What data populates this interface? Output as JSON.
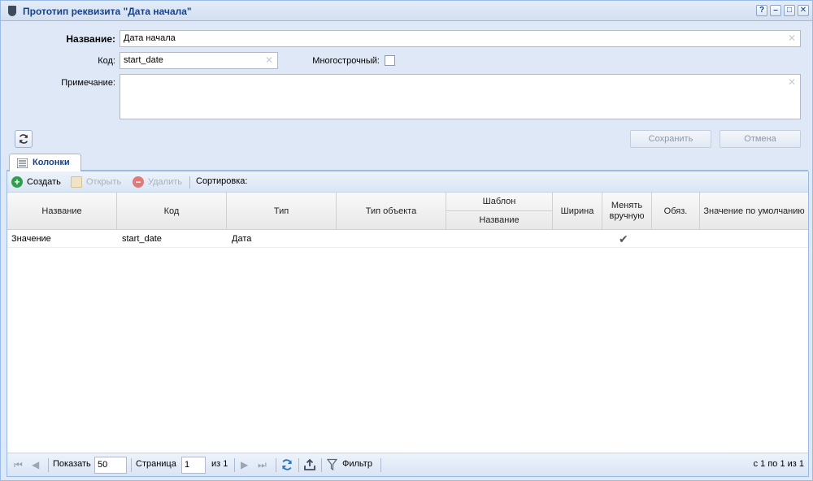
{
  "window": {
    "title": "Прототип реквизита \"Дата начала\"",
    "tools": {
      "help": "?",
      "minimize": "–",
      "maximize": "□",
      "close": "✕"
    }
  },
  "form": {
    "name_label": "Название:",
    "name_value": "Дата начала",
    "code_label": "Код:",
    "code_value": "start_date",
    "multiline_label": "Многострочный:",
    "multiline_checked": false,
    "note_label": "Примечание:",
    "note_value": "",
    "save_label": "Сохранить",
    "cancel_label": "Отмена"
  },
  "tabs": [
    {
      "label": "Колонки",
      "active": true
    }
  ],
  "toolbar": {
    "create_label": "Создать",
    "open_label": "Открыть",
    "delete_label": "Удалить",
    "sort_label": "Сортировка:"
  },
  "grid": {
    "headers": {
      "name": "Название",
      "code": "Код",
      "type": "Тип",
      "object_type": "Тип объекта",
      "template": "Шаблон",
      "template_name": "Название",
      "width": "Ширина",
      "change_manually": "Менять вручную",
      "required": "Обяз.",
      "default_value": "Значение по умолчанию"
    },
    "rows": [
      {
        "name": "Значение",
        "code": "start_date",
        "type": "Дата",
        "object_type": "",
        "template_name": "",
        "width": "",
        "change_manually": "✔",
        "required": "",
        "default_value": ""
      }
    ]
  },
  "pager": {
    "show_label": "Показать",
    "page_size": "50",
    "page_label": "Страница",
    "page_number": "1",
    "of_label": "из 1",
    "filter_label": "Фильтр",
    "range_label": "с 1 по 1 из 1"
  },
  "colors": {
    "accent": "#15428b",
    "frame": "#99bbe8",
    "background": "#dfe8f6",
    "create_icon": "#2f9f4f",
    "delete_icon": "#e07a7a"
  }
}
